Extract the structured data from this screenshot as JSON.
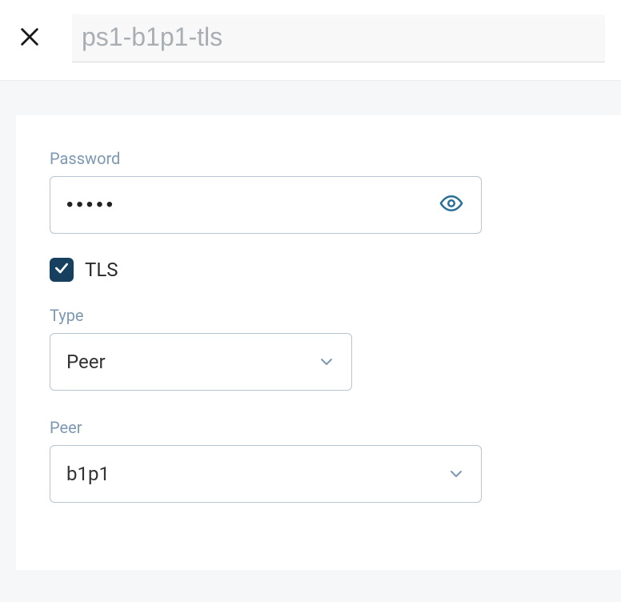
{
  "header": {
    "title_value": "ps1-b1p1-tls"
  },
  "form": {
    "password": {
      "label": "Password",
      "masked_value": "•••••"
    },
    "tls": {
      "label": "TLS",
      "checked": true
    },
    "type": {
      "label": "Type",
      "value": "Peer"
    },
    "peer": {
      "label": "Peer",
      "value": "b1p1"
    }
  }
}
